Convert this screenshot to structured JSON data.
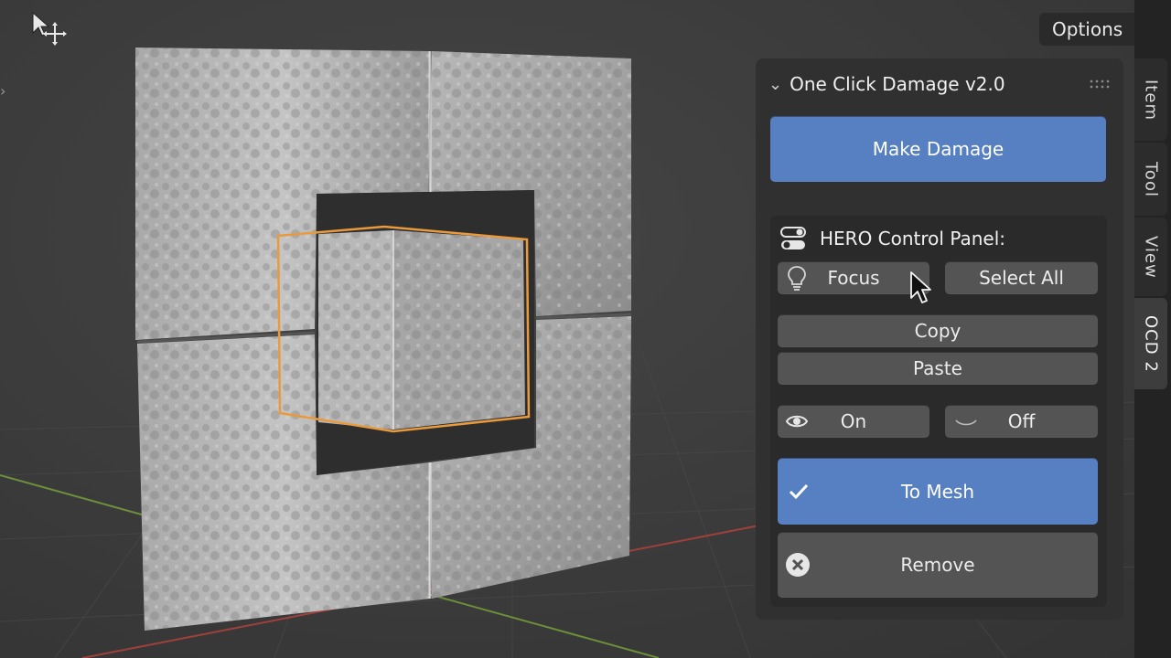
{
  "header": {
    "options_label": "Options"
  },
  "panel": {
    "title": "One Click Damage v2.0",
    "make_damage_label": "Make Damage",
    "hero": {
      "title": "HERO Control Panel:",
      "focus_label": "Focus",
      "select_all_label": "Select All",
      "copy_label": "Copy",
      "paste_label": "Paste",
      "on_label": "On",
      "off_label": "Off",
      "to_mesh_label": "To Mesh",
      "remove_label": "Remove"
    }
  },
  "tabs": [
    {
      "label": "Item"
    },
    {
      "label": "Tool"
    },
    {
      "label": "View"
    },
    {
      "label": "OCD 2",
      "active": true
    }
  ],
  "icons": {
    "tool": "transform-move-icon",
    "focus": "lightbulb-icon",
    "on": "eye-icon",
    "off": "eye-closed-icon",
    "to_mesh": "checkmark-icon",
    "remove": "x-circle-icon",
    "hero": "toggle-icon"
  },
  "colors": {
    "accent_blue": "#5680c2",
    "selection_outline": "#e89a3c",
    "x_axis": "#b0423c",
    "y_axis": "#7aa53a"
  }
}
